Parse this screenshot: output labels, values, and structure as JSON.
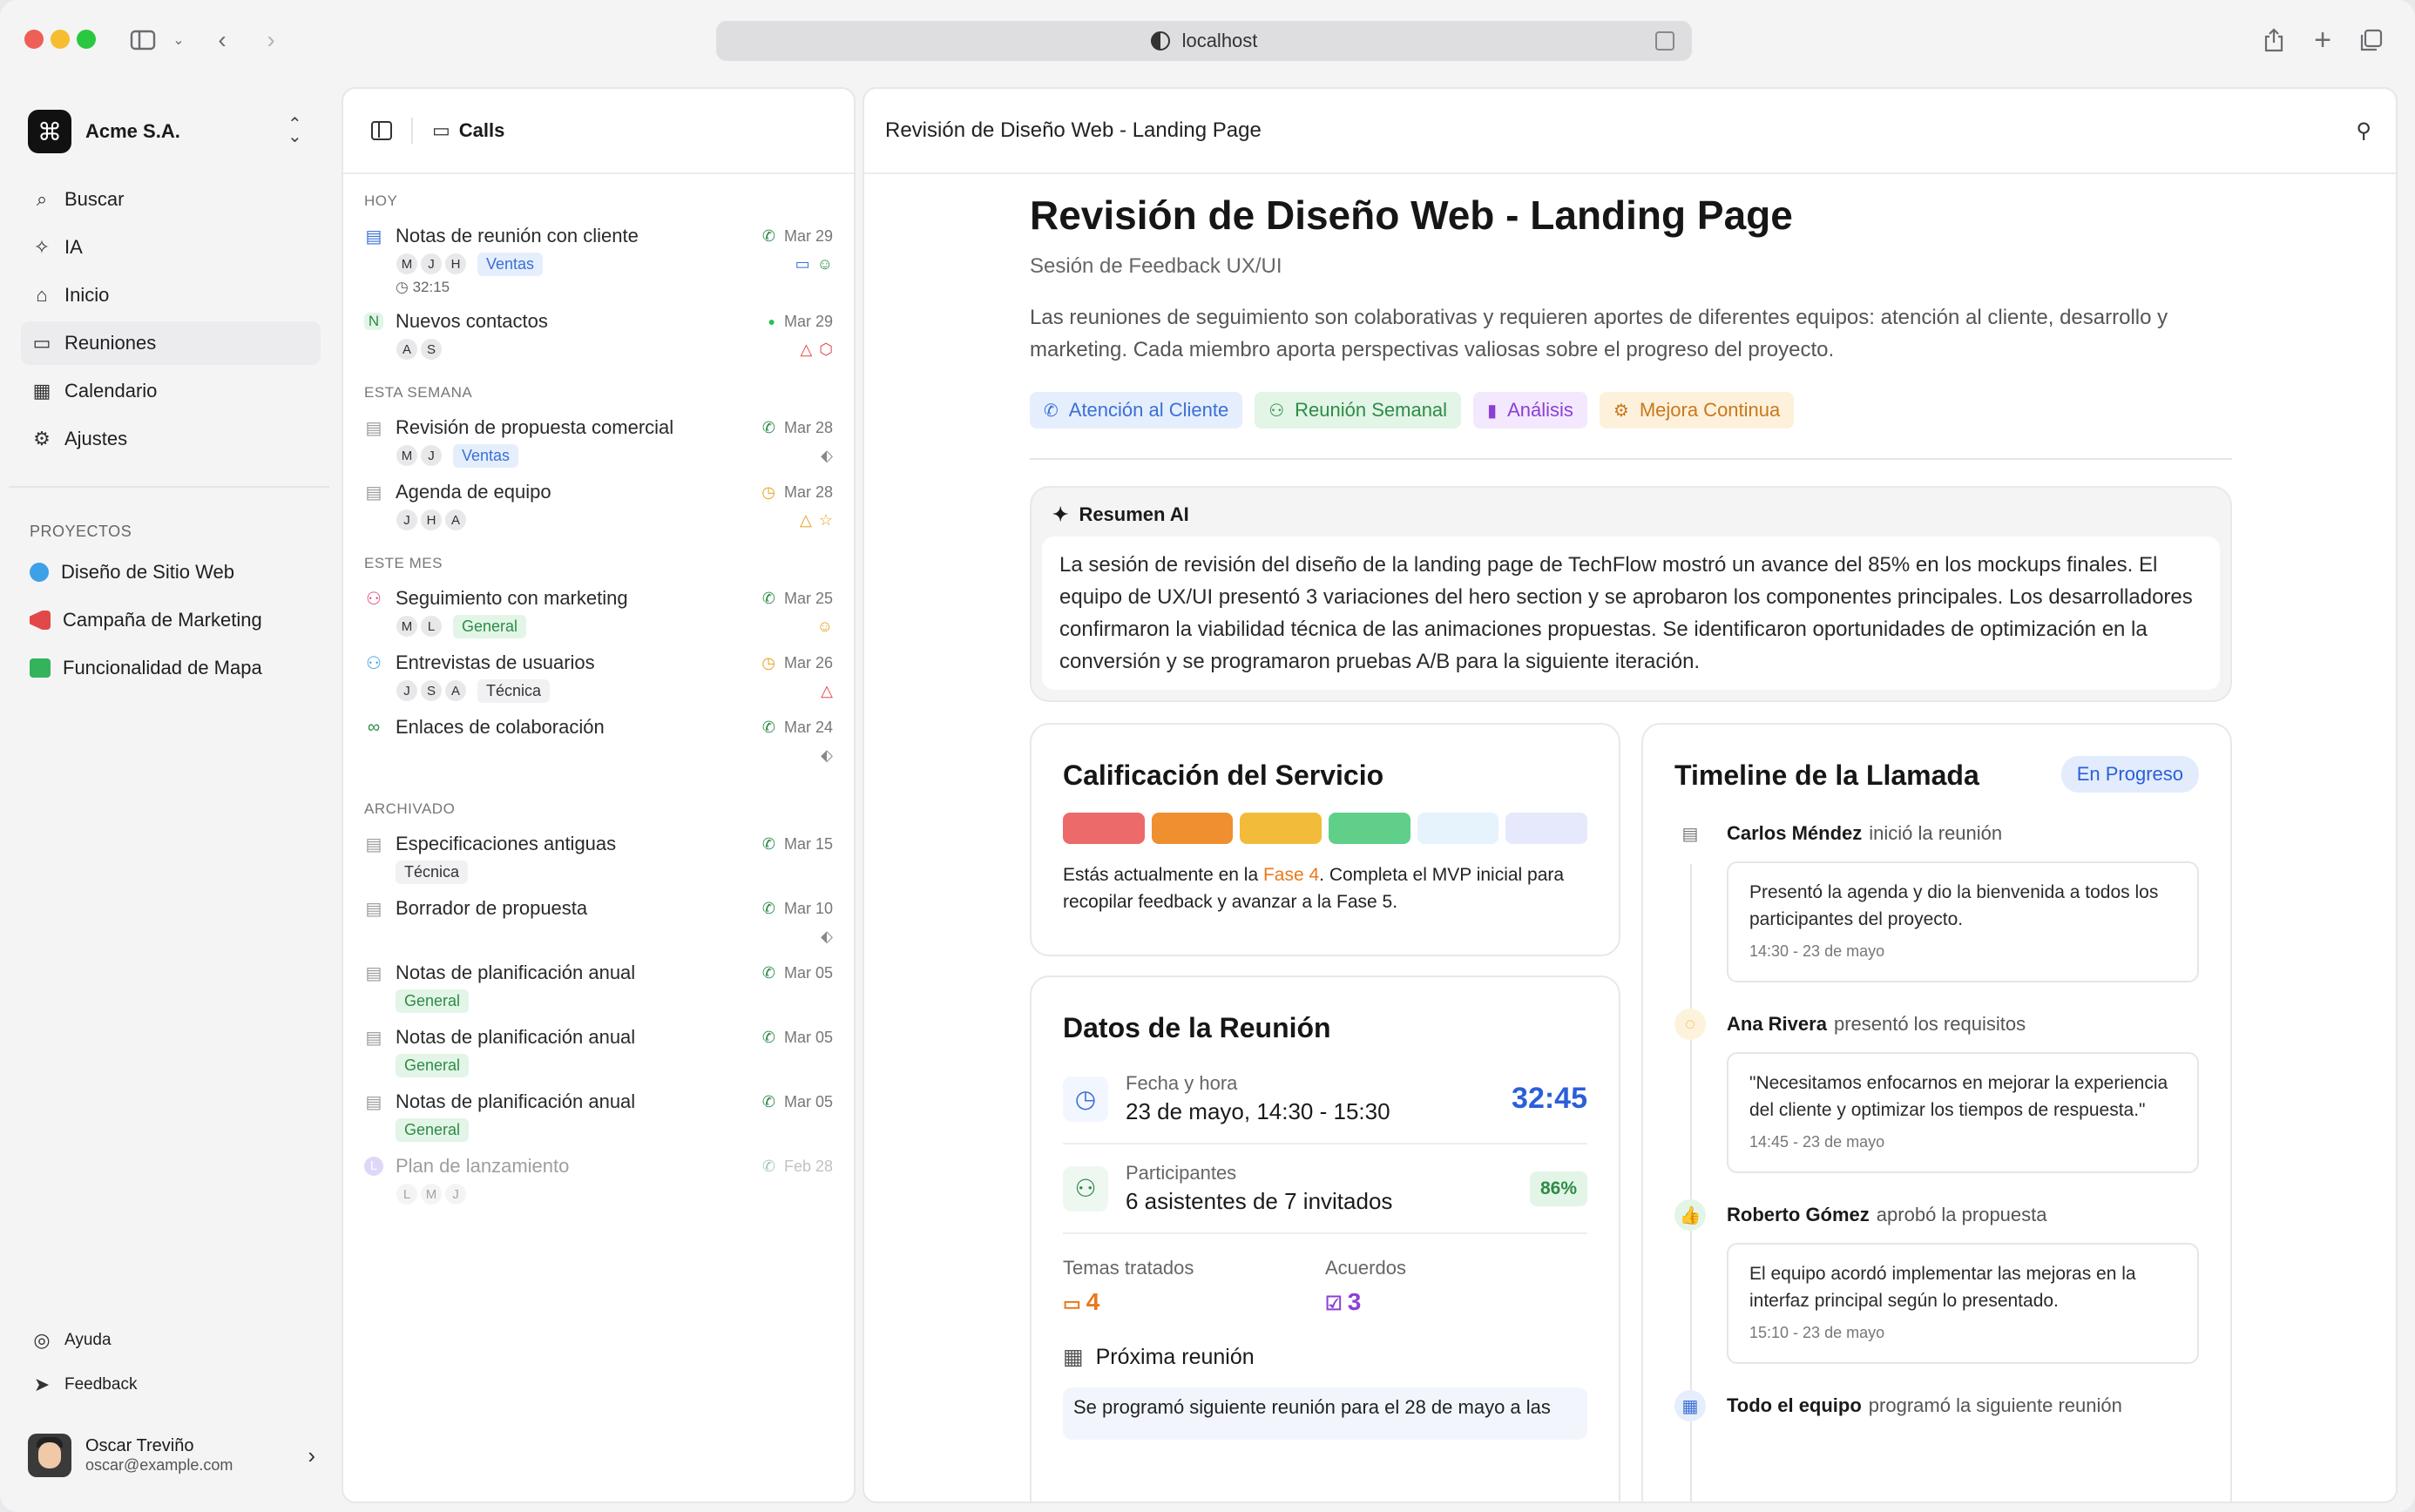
{
  "browser": {
    "url": "localhost"
  },
  "workspace": {
    "name": "Acme S.A."
  },
  "nav": [
    {
      "label": "Buscar",
      "icon": "search-icon"
    },
    {
      "label": "IA",
      "icon": "sparkle-icon"
    },
    {
      "label": "Inicio",
      "icon": "home-icon"
    },
    {
      "label": "Reuniones",
      "icon": "inbox-icon"
    },
    {
      "label": "Calendario",
      "icon": "calendar-icon"
    },
    {
      "label": "Ajustes",
      "icon": "settings-icon"
    }
  ],
  "projects_label": "PROYECTOS",
  "projects": [
    {
      "label": "Diseño de Sitio Web",
      "color": "#3ea0e6"
    },
    {
      "label": "Campaña de Marketing",
      "color": "#e34848"
    },
    {
      "label": "Funcionalidad de Mapa",
      "color": "#33b35a"
    }
  ],
  "bottom": {
    "help": "Ayuda",
    "feedback": "Feedback"
  },
  "user": {
    "name": "Oscar Treviño",
    "email": "oscar@example.com"
  },
  "list": {
    "title": "Calls",
    "groups": {
      "hoy": "HOY",
      "semana": "ESTA SEMANA",
      "mes": "ESTE MES",
      "archivado": "ARCHIVADO"
    },
    "items": [
      {
        "title": "Notas de reunión con cliente",
        "date": "Mar 29",
        "avatars": [
          "M",
          "J",
          "H"
        ],
        "tag": "Ventas",
        "duration": "32:15"
      },
      {
        "title": "Nuevos contactos",
        "date": "Mar 29",
        "avatars": [
          "A",
          "S"
        ],
        "tag": ""
      },
      {
        "title": "Revisión de propuesta comercial",
        "date": "Mar 28",
        "avatars": [
          "M",
          "J"
        ],
        "tag": "Ventas"
      },
      {
        "title": "Agenda de equipo",
        "date": "Mar 28",
        "avatars": [
          "J",
          "H",
          "A"
        ],
        "tag": ""
      },
      {
        "title": "Seguimiento con marketing",
        "date": "Mar 25",
        "avatars": [
          "M",
          "L"
        ],
        "tag": "General"
      },
      {
        "title": "Entrevistas de usuarios",
        "date": "Mar 26",
        "avatars": [
          "J",
          "S",
          "A"
        ],
        "tag": "Técnica"
      },
      {
        "title": "Enlaces de colaboración",
        "date": "Mar 24",
        "avatars": [],
        "tag": ""
      },
      {
        "title": "Especificaciones antiguas",
        "date": "Mar 15",
        "avatars": [],
        "tag": "Técnica"
      },
      {
        "title": "Borrador de propuesta",
        "date": "Mar 10",
        "avatars": [],
        "tag": ""
      },
      {
        "title": "Notas de planificación anual",
        "date": "Mar 05",
        "avatars": [],
        "tag": "General"
      },
      {
        "title": "Notas de planificación anual",
        "date": "Mar 05",
        "avatars": [],
        "tag": "General"
      },
      {
        "title": "Notas de planificación anual",
        "date": "Mar 05",
        "avatars": [],
        "tag": "General"
      },
      {
        "title": "Plan de lanzamiento",
        "date": "Feb 28",
        "avatars": [
          "L",
          "M",
          "J"
        ],
        "tag": "",
        "initial": "L"
      }
    ]
  },
  "main": {
    "header_title": "Revisión de Diseño Web - Landing Page",
    "title": "Revisión de Diseño Web - Landing Page",
    "subtitle": "Sesión de Feedback UX/UI",
    "description": "Las reuniones de seguimiento son colaborativas y requieren aportes de diferentes equipos: atención al cliente, desarrollo y marketing. Cada miembro aporta perspectivas valiosas sobre el progreso del proyecto.",
    "chips": [
      {
        "label": "Atención al Cliente",
        "bg": "#e5eefc",
        "color": "#3b6fd6",
        "icon": "phone-icon"
      },
      {
        "label": "Reunión Semanal",
        "bg": "#e2f5e6",
        "color": "#2e8b48",
        "icon": "users-icon"
      },
      {
        "label": "Análisis",
        "bg": "#f3e8fd",
        "color": "#8b3fd6",
        "icon": "chart-icon"
      },
      {
        "label": "Mejora Continua",
        "bg": "#fdf1dc",
        "color": "#c9781a",
        "icon": "gear-icon"
      }
    ],
    "ai": {
      "title": "Resumen AI",
      "text": "La sesión de revisión del diseño de la landing page de TechFlow mostró un avance del 85% en los mockups finales. El equipo de UX/UI presentó 3 variaciones del hero section y se aprobaron los componentes principales. Los desarrolladores confirmaron la viabilidad técnica de las animaciones propuestas. Se identificaron oportunidades de optimización en la conversión y se programaron pruebas A/B para la siguiente iteración."
    },
    "rating": {
      "title": "Calificación del Servicio",
      "colors": [
        "#ec6a6a",
        "#ef8f2f",
        "#f3bb3a",
        "#5fcf8a",
        "#e6f2fc",
        "#e6e9fb"
      ],
      "text_pre": "Estás actualmente en la ",
      "phase": "Fase 4",
      "text_post": ". Completa el MVP inicial para recopilar feedback y avanzar a la Fase 5."
    },
    "datos": {
      "title": "Datos de la Reunión",
      "fecha_label": "Fecha y hora",
      "fecha_value": "23 de mayo, 14:30 - 15:30",
      "duration": "32:45",
      "part_label": "Participantes",
      "part_value": "6 asistentes de 7 invitados",
      "part_pct": "86%",
      "temas_label": "Temas tratados",
      "temas_value": "4",
      "acuerdos_label": "Acuerdos",
      "acuerdos_value": "3",
      "prox_label": "Próxima reunión",
      "prox_text": "Se programó siguiente reunión para el 28 de mayo a las"
    },
    "timeline": {
      "title": "Timeline de la Llamada",
      "status": "En Progreso",
      "events": [
        {
          "who": "Carlos Méndez",
          "action": "inició la reunión",
          "text": "Presentó la agenda y dio la bienvenida a todos los participantes del proyecto.",
          "time": "14:30 - 23 de mayo",
          "icon": "document-icon",
          "color": "#777"
        },
        {
          "who": "Ana Rivera",
          "action": "presentó los requisitos",
          "text": "\"Necesitamos enfocarnos en mejorar la experiencia del cliente y optimizar los tiempos de respuesta.\"",
          "time": "14:45 - 23 de mayo",
          "icon": "chat-icon",
          "color": "#e8a21d"
        },
        {
          "who": "Roberto Gómez",
          "action": "aprobó la propuesta",
          "text": "El equipo acordó implementar las mejoras en la interfaz principal según lo presentado.",
          "time": "15:10 - 23 de mayo",
          "icon": "thumbs-up-icon",
          "color": "#2e8b48"
        },
        {
          "who": "Todo el equipo",
          "action": "programó la siguiente reunión",
          "text": "",
          "time": "",
          "icon": "calendar-icon",
          "color": "#3b6fd6"
        }
      ]
    }
  }
}
